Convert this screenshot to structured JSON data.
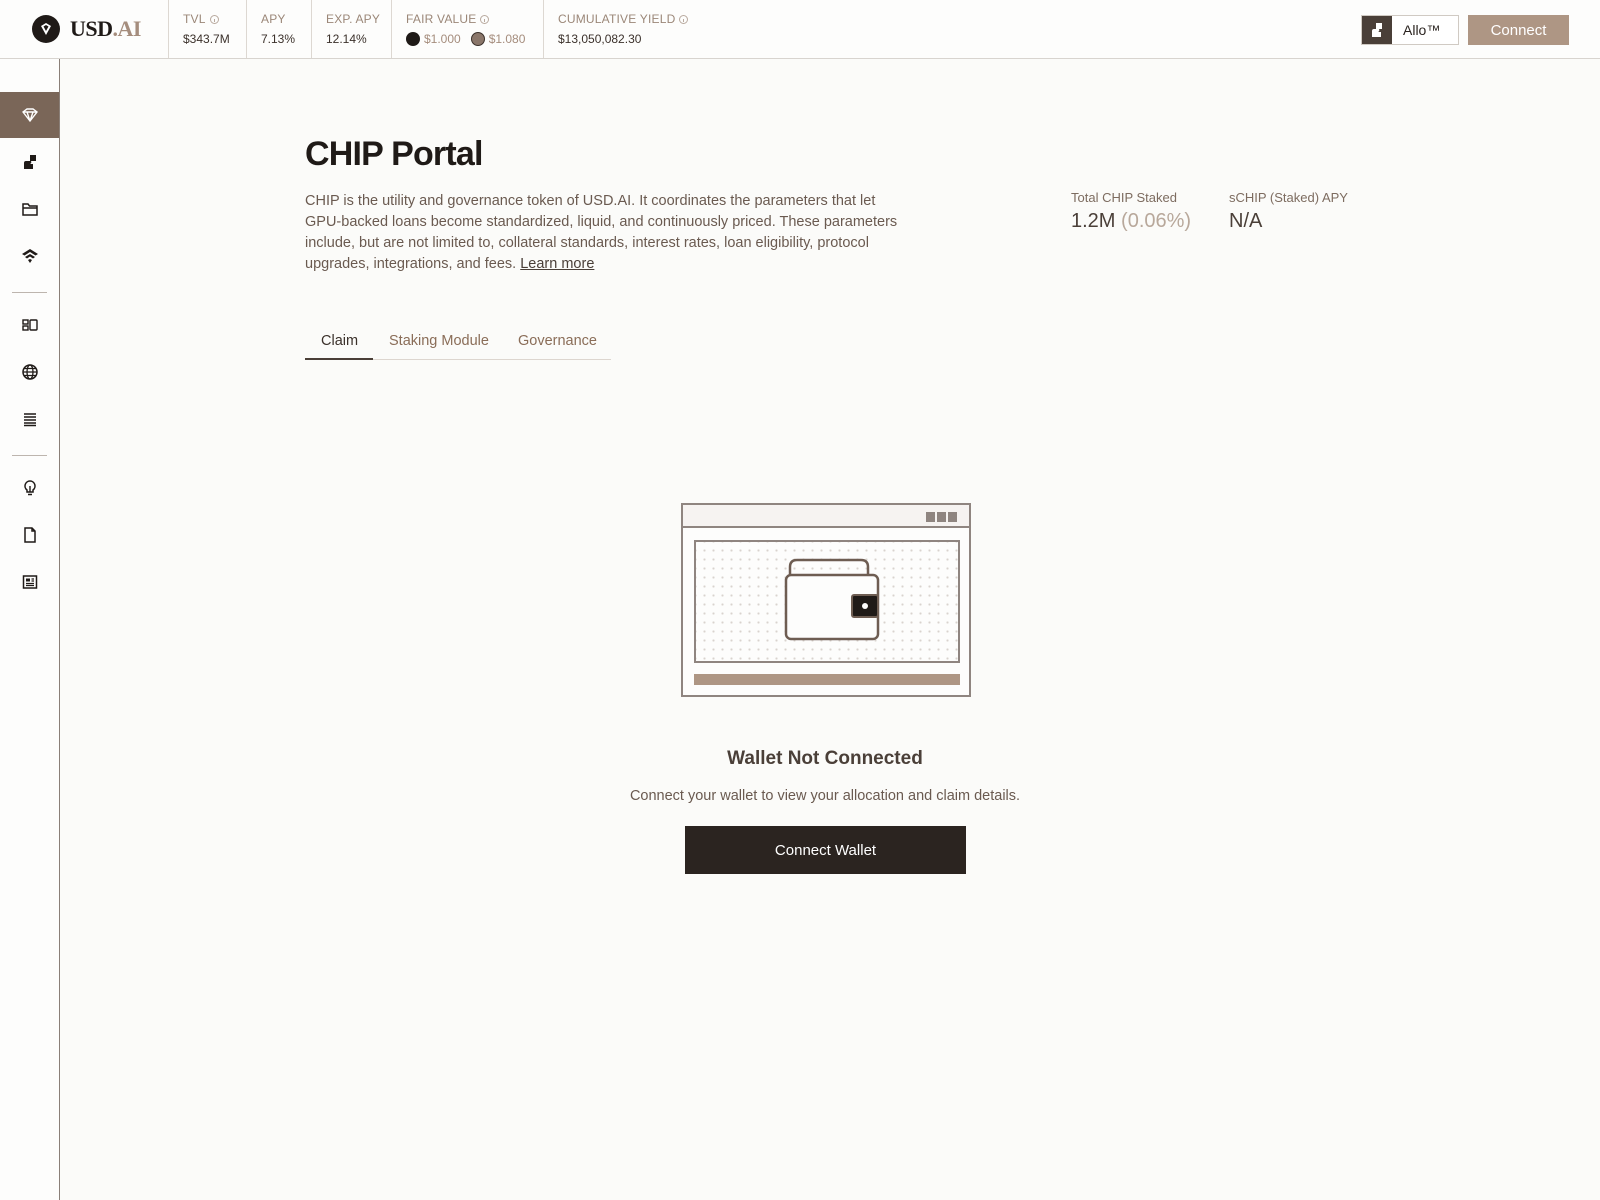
{
  "brand": {
    "name_main": "USD",
    "name_suffix": ".AI"
  },
  "stats": [
    {
      "label": "TVL",
      "value": "$343.7M",
      "info": true
    },
    {
      "label": "APY",
      "value": "7.13%",
      "info": false
    },
    {
      "label": "EXP. APY",
      "value": "12.14%",
      "info": false
    },
    {
      "label": "FAIR VALUE",
      "value1": "$1.000",
      "value2": "$1.080",
      "info": true
    },
    {
      "label": "CUMULATIVE YIELD",
      "value": "$13,050,082.30",
      "info": true
    }
  ],
  "header": {
    "allo_label": "Allo™",
    "connect_label": "Connect"
  },
  "colors": {
    "accent": "#ae9684",
    "dark": "#2b2420",
    "sidebar_active": "#7a6658",
    "muted_text": "#6a5a50"
  },
  "sidebar": {
    "items": [
      {
        "icon": "diamond-gem-icon",
        "active": true
      },
      {
        "icon": "hand-coin-icon",
        "active": false
      },
      {
        "icon": "folder-icon",
        "active": false
      },
      {
        "icon": "layers-wifi-icon",
        "active": false
      },
      {
        "icon": "dashboard-tiles-icon",
        "active": false
      },
      {
        "icon": "globe-icon",
        "active": false
      },
      {
        "icon": "stacked-list-icon",
        "active": false
      },
      {
        "icon": "lightbulb-icon",
        "active": false
      },
      {
        "icon": "document-icon",
        "active": false
      },
      {
        "icon": "newspaper-icon",
        "active": false
      }
    ]
  },
  "page": {
    "title": "CHIP Portal",
    "description": "CHIP is the utility and governance token of USD.AI. It coordinates the parameters that let GPU-backed loans become standardized, liquid, and continuously priced. These parameters include, but are not limited to, collateral standards, interest rates, loan eligibility, protocol upgrades, integrations, and fees.",
    "learn_more": "Learn more",
    "kpis": {
      "staked_label": "Total CHIP Staked",
      "staked_value": "1.2M",
      "staked_pct": "(0.06%)",
      "apy_label": "sCHIP (Staked) APY",
      "apy_value": "N/A"
    },
    "tabs": [
      {
        "label": "Claim",
        "active": true
      },
      {
        "label": "Staking Module",
        "active": false
      },
      {
        "label": "Governance",
        "active": false
      }
    ]
  },
  "empty_state": {
    "title": "Wallet Not Connected",
    "text": "Connect your wallet to view your allocation and claim details.",
    "button": "Connect Wallet"
  }
}
